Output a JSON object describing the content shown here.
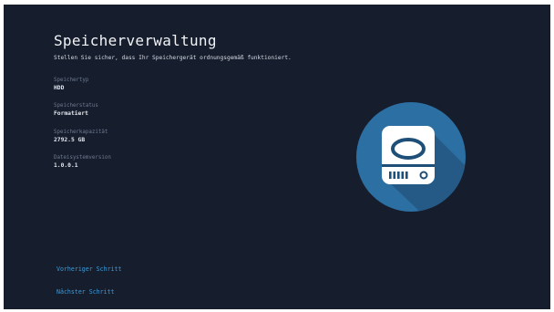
{
  "page": {
    "title": "Speicherverwaltung",
    "subtitle": "Stellen Sie sicher, dass Ihr Speichergerät ordnungsgemäß funktioniert."
  },
  "fields": [
    {
      "label": "Speichertyp",
      "value": "HDD"
    },
    {
      "label": "Speicherstatus",
      "value": "Formatiert"
    },
    {
      "label": "Speicherkapazität",
      "value": "2792.5 GB"
    },
    {
      "label": "Dateisystemversion",
      "value": "1.0.0.1"
    }
  ],
  "navigation": {
    "previous_label": "Vorheriger Schritt",
    "next_label": "Nächster Schritt"
  },
  "graphic": {
    "icon": "hard-drive-icon",
    "circle_color": "#2c6fa3",
    "shadow_color": "#245a85",
    "device_color": "#ffffff",
    "detail_color": "#1e4f78"
  },
  "colors": {
    "background": "#161d2d",
    "accent": "#3f9bd8",
    "label": "#6f7b90"
  }
}
